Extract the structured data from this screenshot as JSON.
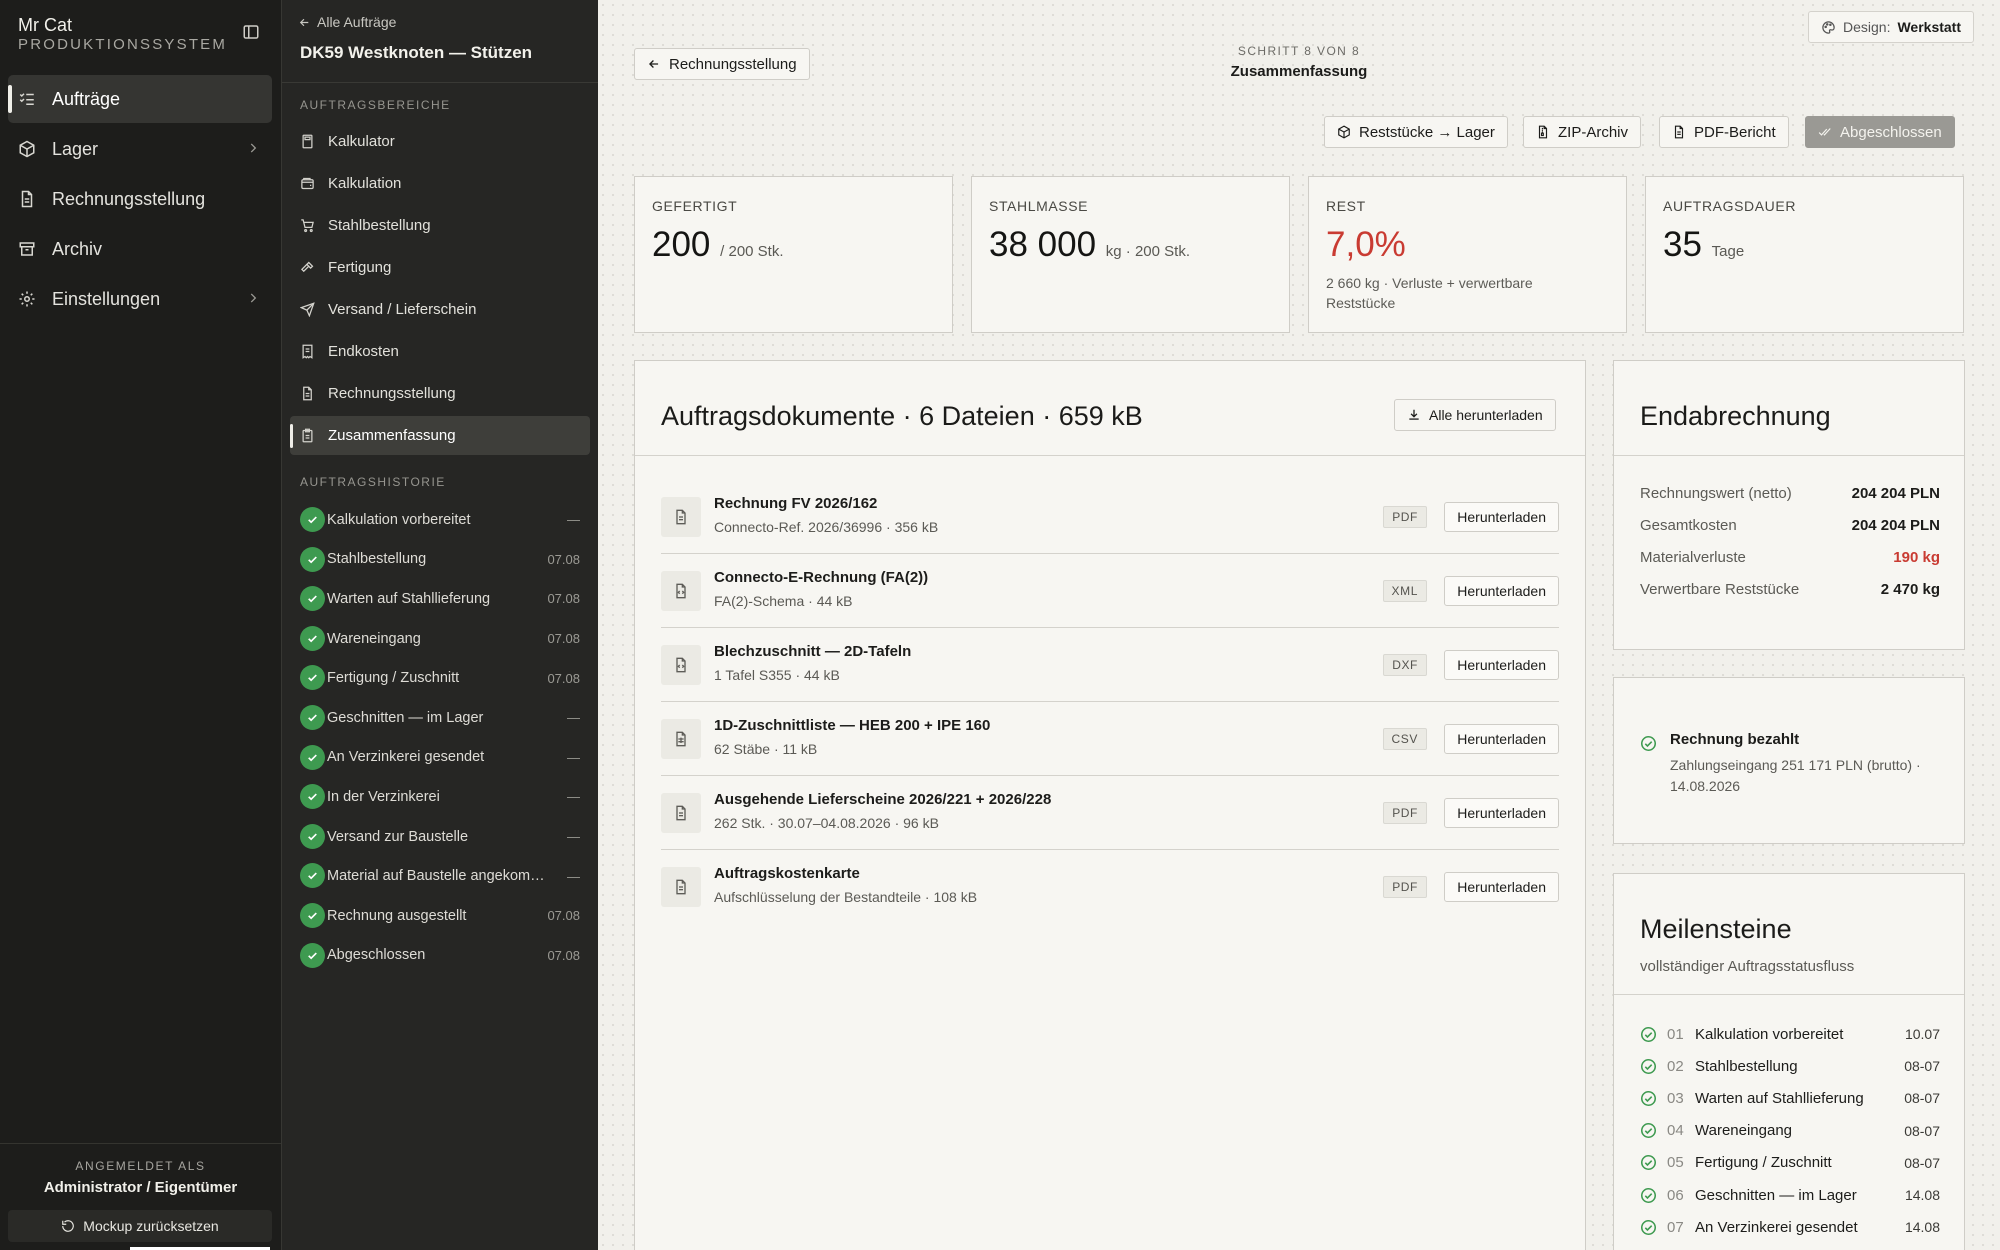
{
  "app": {
    "name": "Mr Cat",
    "subtitle": "PRODUKTIONSSYSTEM"
  },
  "nav": [
    {
      "label": "Aufträge",
      "icon": "list-check-icon",
      "active": true
    },
    {
      "label": "Lager",
      "icon": "box-icon",
      "chevron": true
    },
    {
      "label": "Rechnungsstellung",
      "icon": "document-icon"
    },
    {
      "label": "Archiv",
      "icon": "archive-icon"
    },
    {
      "label": "Einstellungen",
      "icon": "gear-icon",
      "chevron": true
    }
  ],
  "user": {
    "label": "ANGEMELDET ALS",
    "name": "Administrator / Eigentümer",
    "reset": "Mockup zurücksetzen"
  },
  "job": {
    "back": "Alle Aufträge",
    "title": "DK59 Westknoten — Stützen"
  },
  "areas_heading": "AUFTRAGSBEREICHE",
  "areas": [
    {
      "label": "Kalkulator",
      "icon": "calculator-icon"
    },
    {
      "label": "Kalkulation",
      "icon": "wallet-icon"
    },
    {
      "label": "Stahlbestellung",
      "icon": "cart-icon"
    },
    {
      "label": "Fertigung",
      "icon": "hammer-icon"
    },
    {
      "label": "Versand / Lieferschein",
      "icon": "send-icon"
    },
    {
      "label": "Endkosten",
      "icon": "receipt-icon"
    },
    {
      "label": "Rechnungsstellung",
      "icon": "document-icon"
    },
    {
      "label": "Zusammenfassung",
      "icon": "clipboard-icon",
      "active": true
    }
  ],
  "history_heading": "AUFTRAGSHISTORIE",
  "history": [
    {
      "label": "Kalkulation vorbereitet",
      "date": "—"
    },
    {
      "label": "Stahlbestellung",
      "date": "07.08"
    },
    {
      "label": "Warten auf Stahllieferung",
      "date": "07.08"
    },
    {
      "label": "Wareneingang",
      "date": "07.08"
    },
    {
      "label": "Fertigung / Zuschnitt",
      "date": "07.08"
    },
    {
      "label": "Geschnitten — im Lager",
      "date": "—"
    },
    {
      "label": "An Verzinkerei gesendet",
      "date": "—"
    },
    {
      "label": "In der Verzinkerei",
      "date": "—"
    },
    {
      "label": "Versand zur Baustelle",
      "date": "—"
    },
    {
      "label": "Material auf Baustelle angekommen",
      "date": "—"
    },
    {
      "label": "Rechnung ausgestellt",
      "date": "07.08"
    },
    {
      "label": "Abgeschlossen",
      "date": "07.08"
    }
  ],
  "header": {
    "back_button": "Rechnungsstellung",
    "step": "SCHRITT 8 VON 8",
    "step_title": "Zusammenfassung",
    "design_label": "Design:",
    "design_value": "Werkstatt",
    "actions": [
      "Reststücke → Lager",
      "ZIP-Archiv",
      "PDF-Bericht",
      "Abgeschlossen"
    ]
  },
  "stats": [
    {
      "label": "GEFERTIGT",
      "value": "200",
      "unit": "/ 200 Stk.",
      "sub": ""
    },
    {
      "label": "STAHLMASSE",
      "value": "38 000",
      "unit": "kg · 200 Stk.",
      "sub": ""
    },
    {
      "label": "REST",
      "value": "7,0%",
      "unit": "",
      "sub": "2 660 kg · Verluste + verwertbare Reststücke",
      "red": true
    },
    {
      "label": "AUFTRAGSDAUER",
      "value": "35",
      "unit": "Tage",
      "sub": ""
    }
  ],
  "docs": {
    "title": "Auftragsdokumente · 6 Dateien · 659 kB",
    "download_all": "Alle herunterladen",
    "download_label": "Herunterladen",
    "items": [
      {
        "title": "Rechnung FV 2026/162",
        "sub": "Connecto-Ref. 2026/36996 · 356 kB",
        "type": "PDF",
        "icon": "document-icon"
      },
      {
        "title": "Connecto-E-Rechnung (FA(2))",
        "sub": "FA(2)-Schema · 44 kB",
        "type": "XML",
        "icon": "code-file-icon"
      },
      {
        "title": "Blechzuschnitt — 2D-Tafeln",
        "sub": "1 Tafel S355 · 44 kB",
        "type": "DXF",
        "icon": "code-file-icon"
      },
      {
        "title": "1D-Zuschnittliste — HEB 200 + IPE 160",
        "sub": "62 Stäbe · 11 kB",
        "type": "CSV",
        "icon": "spreadsheet-icon"
      },
      {
        "title": "Ausgehende Lieferscheine 2026/221 + 2026/228",
        "sub": "262 Stk. · 30.07–04.08.2026 · 96 kB",
        "type": "PDF",
        "icon": "document-icon"
      },
      {
        "title": "Auftragskostenkarte",
        "sub": "Aufschlüsselung der Bestandteile · 108 kB",
        "type": "PDF",
        "icon": "document-icon"
      }
    ]
  },
  "settlement": {
    "title": "Endabrechnung",
    "rows": [
      {
        "k": "Rechnungswert (netto)",
        "v": "204 204 PLN"
      },
      {
        "k": "Gesamtkosten",
        "v": "204 204 PLN"
      },
      {
        "k": "Materialverluste",
        "v": "190 kg",
        "red": true
      },
      {
        "k": "Verwertbare Reststücke",
        "v": "2 470 kg"
      }
    ]
  },
  "paid": {
    "title": "Rechnung bezahlt",
    "sub": "Zahlungseingang 251 171 PLN (brutto) · 14.08.2026"
  },
  "milestones": {
    "title": "Meilensteine",
    "subtitle": "vollständiger Auftragsstatusfluss",
    "items": [
      {
        "n": "01",
        "label": "Kalkulation vorbereitet",
        "date": "10.07"
      },
      {
        "n": "02",
        "label": "Stahlbestellung",
        "date": "08-07"
      },
      {
        "n": "03",
        "label": "Warten auf Stahllieferung",
        "date": "08-07"
      },
      {
        "n": "04",
        "label": "Wareneingang",
        "date": "08-07"
      },
      {
        "n": "05",
        "label": "Fertigung / Zuschnitt",
        "date": "08-07"
      },
      {
        "n": "06",
        "label": "Geschnitten — im Lager",
        "date": "14.08"
      },
      {
        "n": "07",
        "label": "An Verzinkerei gesendet",
        "date": "14.08"
      }
    ]
  },
  "colors": {
    "sidebar": "#1d1d1b",
    "secondary": "#262624",
    "accent_green": "#3e9a50",
    "danger": "#c93b32"
  }
}
